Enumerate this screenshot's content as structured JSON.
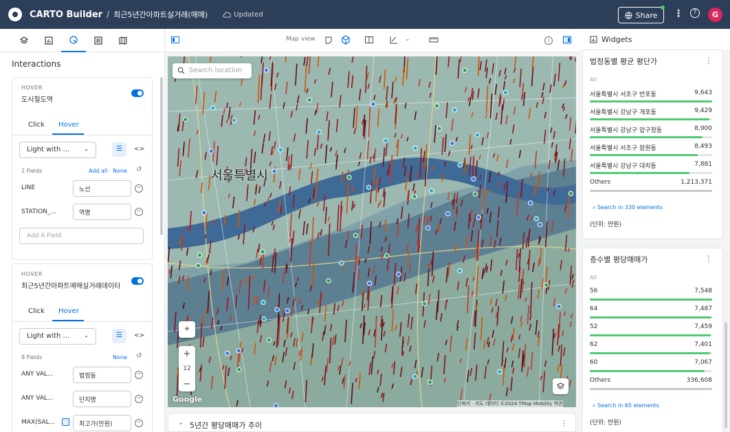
{
  "topbar": {
    "brand": "CARTO Builder",
    "separator": "/",
    "map_name": "최근5년간아파트실거래(매매)",
    "status": "Updated",
    "share_label": "Share",
    "avatar_initial": "G"
  },
  "left_panel": {
    "section_title": "Interactions",
    "layers": [
      {
        "hover_label": "HOVER",
        "layer_name": "도시철도역",
        "tabs": [
          "Click",
          "Hover"
        ],
        "template": "Light with ...",
        "fields_count": "2 Fields",
        "add_all": "Add all",
        "none": "None",
        "fields": [
          {
            "name": "LINE",
            "value": "노선"
          },
          {
            "name": "STATION_...",
            "value": "역명"
          }
        ],
        "add_field_placeholder": "Add A Field"
      },
      {
        "hover_label": "HOVER",
        "layer_name": "최근5년간아파트매매실거래데이터",
        "tabs": [
          "Click",
          "Hover"
        ],
        "template": "Light with ...",
        "fields_count": "8 Fields",
        "none": "None",
        "fields": [
          {
            "name": "ANY VAL...",
            "value": "법정동"
          },
          {
            "name": "ANY VAL...",
            "value": "단지명"
          },
          {
            "name": "MAX(SAL...",
            "value": "최고가(만원)"
          }
        ]
      }
    ]
  },
  "map_toolbar": {
    "map_view_label": "Map view"
  },
  "map": {
    "search_placeholder": "Search location",
    "city_label": "서울특별시",
    "zoom_level": "12",
    "attribution": "단축키 · 지도 데이터 ©2024 TMap Mobility  약관",
    "google_logo": "Google",
    "bottom_title": "5년간 평당매매가 추이"
  },
  "right_panel": {
    "header": "Widgets",
    "widgets": [
      {
        "title": "법정동별 평균 평단가",
        "all": "All",
        "rows": [
          {
            "label": "서울특별시 서초구 반포동",
            "value": "9,643",
            "fraction": 1.0
          },
          {
            "label": "서울특별시 강남구 개포동",
            "value": "9,429",
            "fraction": 0.978
          },
          {
            "label": "서울특별시 강남구 압구정동",
            "value": "8,900",
            "fraction": 0.923
          },
          {
            "label": "서울특별시 서초구 잠원동",
            "value": "8,493",
            "fraction": 0.881
          },
          {
            "label": "서울특별시 강남구 대치동",
            "value": "7,881",
            "fraction": 0.817
          }
        ],
        "others": {
          "label": "Others",
          "value": "1,213,371",
          "fraction": 1.0
        },
        "search": "Search in 330 elements",
        "unit": "(단위: 만원)"
      },
      {
        "title": "층수별 평당매매가",
        "all": "All",
        "rows": [
          {
            "label": "56",
            "value": "7,548",
            "fraction": 1.0
          },
          {
            "label": "64",
            "value": "7,487",
            "fraction": 0.992
          },
          {
            "label": "52",
            "value": "7,459",
            "fraction": 0.988
          },
          {
            "label": "62",
            "value": "7,401",
            "fraction": 0.981
          },
          {
            "label": "60",
            "value": "7,067",
            "fraction": 0.936
          }
        ],
        "others": {
          "label": "Others",
          "value": "336,608",
          "fraction": 1.0
        },
        "search": "Search in 65 elements",
        "unit": "(단위: 만원)"
      }
    ]
  },
  "colors": {
    "topbar": "#2c3e58",
    "accent": "#036fe2",
    "bar": "#4ecb71",
    "water": "#4a6a8f"
  }
}
